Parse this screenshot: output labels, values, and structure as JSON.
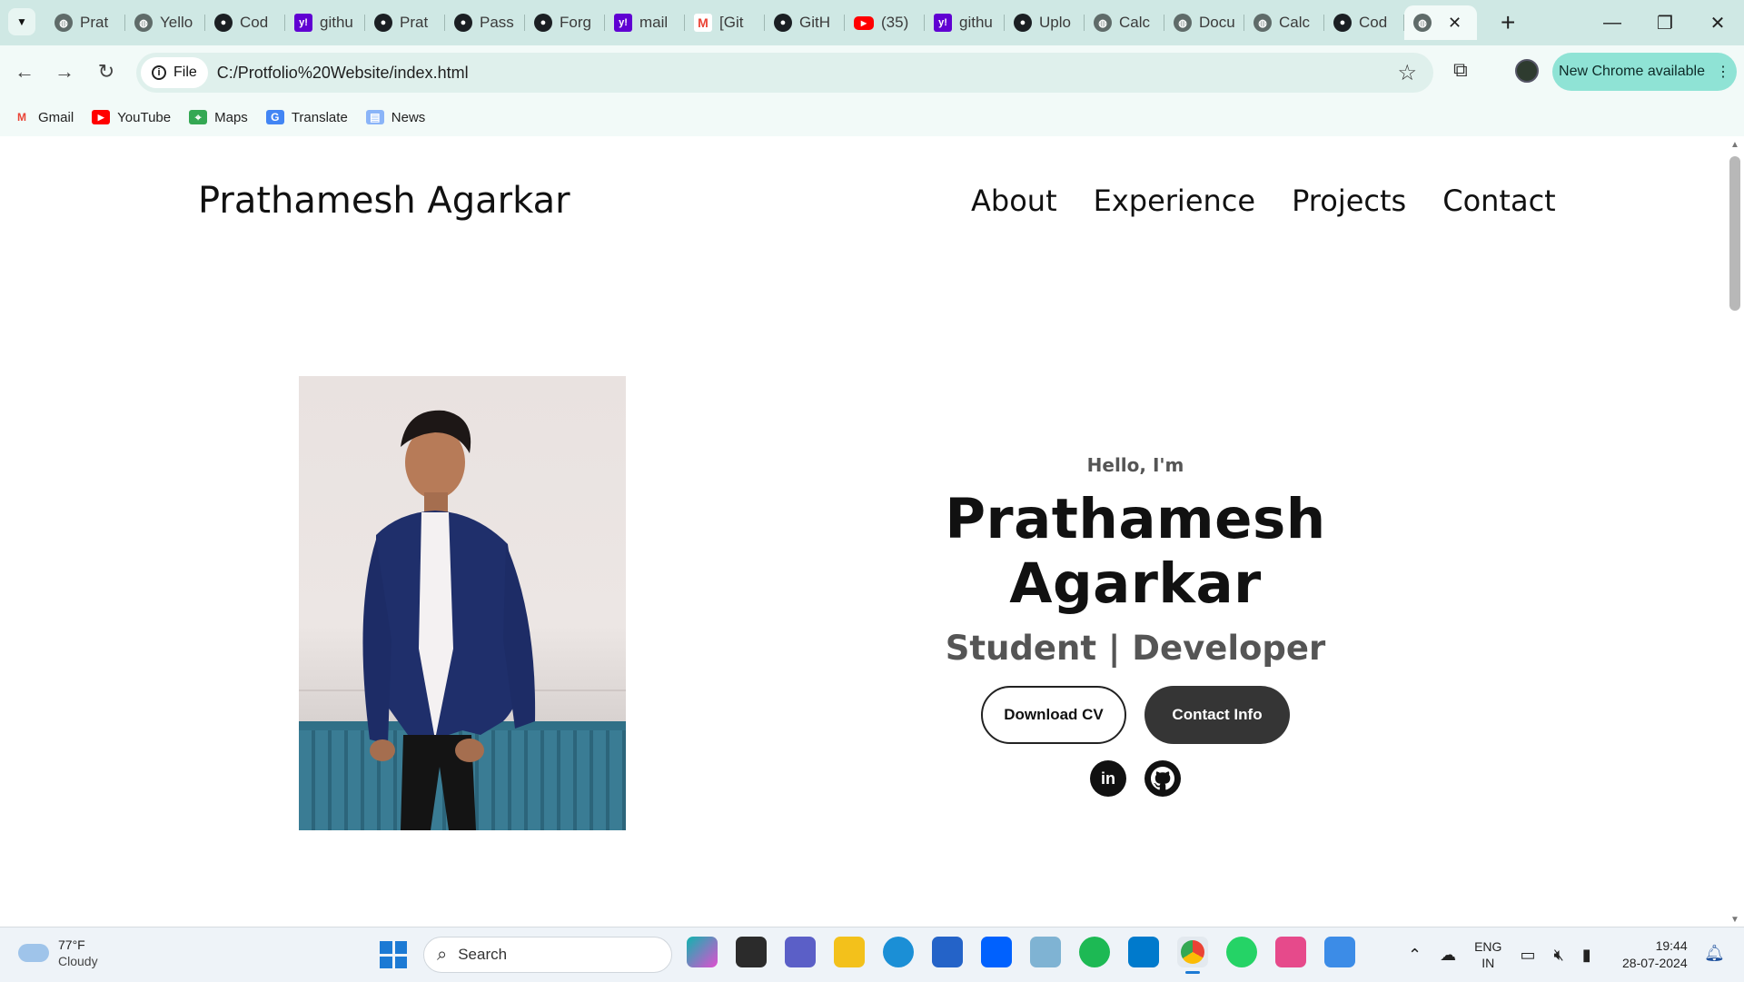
{
  "browser": {
    "tabs": [
      {
        "title": "Prat",
        "icon": "globe-icon"
      },
      {
        "title": "Yello",
        "icon": "globe-icon"
      },
      {
        "title": "Cod",
        "icon": "github-icon"
      },
      {
        "title": "githu",
        "icon": "yahoo-icon"
      },
      {
        "title": "Prat",
        "icon": "github-icon"
      },
      {
        "title": "Pass",
        "icon": "github-icon"
      },
      {
        "title": "Forg",
        "icon": "github-icon"
      },
      {
        "title": "mail",
        "icon": "yahoo-icon"
      },
      {
        "title": "[Git",
        "icon": "gmail-icon"
      },
      {
        "title": "GitH",
        "icon": "github-icon"
      },
      {
        "title": "(35)",
        "icon": "youtube-icon"
      },
      {
        "title": "githu",
        "icon": "yahoo-icon"
      },
      {
        "title": "Uplo",
        "icon": "github-icon"
      },
      {
        "title": "Calc",
        "icon": "globe-icon"
      },
      {
        "title": "Docu",
        "icon": "globe-icon"
      },
      {
        "title": "Calc",
        "icon": "globe-icon"
      },
      {
        "title": "Cod",
        "icon": "github-icon"
      }
    ],
    "active_tab_icon": "globe-icon",
    "address": {
      "scheme_chip": "File",
      "url": "C:/Protfolio%20Website/index.html"
    },
    "update_button": "New Chrome available",
    "bookmarks": [
      {
        "label": "Gmail",
        "icon": "gmail-icon"
      },
      {
        "label": "YouTube",
        "icon": "youtube-icon"
      },
      {
        "label": "Maps",
        "icon": "maps-icon"
      },
      {
        "label": "Translate",
        "icon": "translate-icon"
      },
      {
        "label": "News",
        "icon": "news-icon"
      }
    ]
  },
  "page": {
    "logo": "Prathamesh Agarkar",
    "nav": [
      "About",
      "Experience",
      "Projects",
      "Contact"
    ],
    "hero": {
      "greeting": "Hello, I'm",
      "name": "Prathamesh Agarkar",
      "role": "Student | Developer",
      "buttons": {
        "download": "Download CV",
        "contact": "Contact Info"
      },
      "socials": [
        "linkedin-icon",
        "github-icon"
      ]
    }
  },
  "taskbar": {
    "weather": {
      "temp": "77°F",
      "condition": "Cloudy"
    },
    "search_placeholder": "Search",
    "language": {
      "line1": "ENG",
      "line2": "IN"
    },
    "time": "19:44",
    "date": "28-07-2024"
  },
  "colors": {
    "tabstrip": "#cfe8e4",
    "toolbar": "#f2faf8",
    "update_button": "#8fe3d5",
    "solid_button": "#353535"
  }
}
